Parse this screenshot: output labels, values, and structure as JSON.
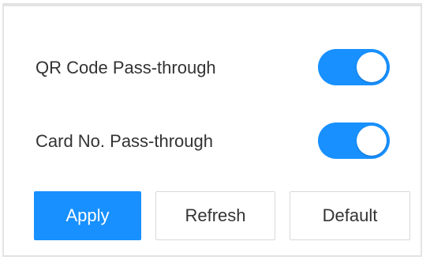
{
  "settings": {
    "qr_code": {
      "label": "QR Code Pass-through",
      "enabled": true
    },
    "card_no": {
      "label": "Card No. Pass-through",
      "enabled": true
    }
  },
  "actions": {
    "apply_label": "Apply",
    "refresh_label": "Refresh",
    "default_label": "Default"
  },
  "colors": {
    "accent": "#1890ff",
    "text": "#333333",
    "border": "#d9d9d9"
  }
}
